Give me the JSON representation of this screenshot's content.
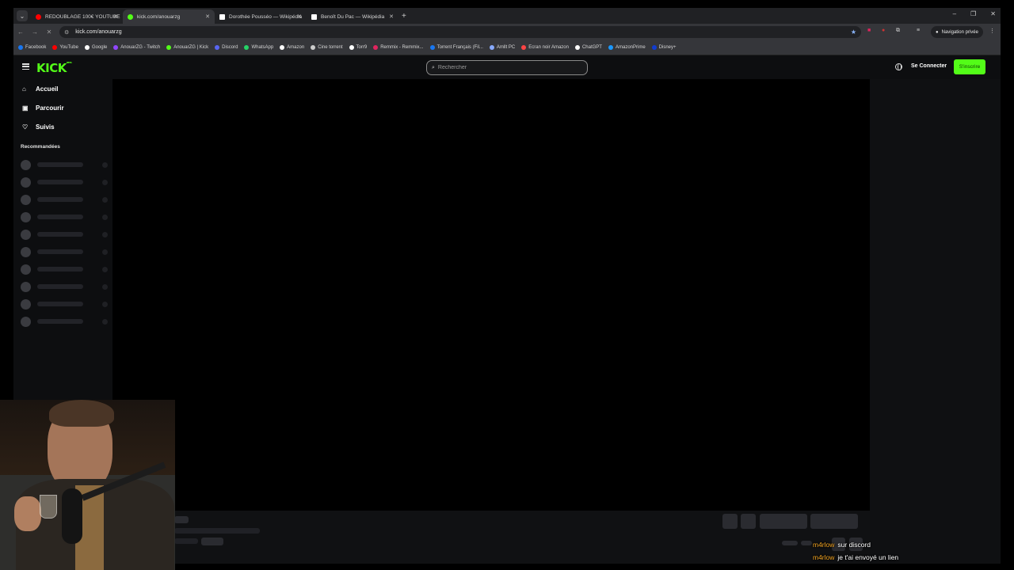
{
  "browser": {
    "tabs": [
      {
        "title": "REDOUBLAGE 100€ YOUTUBE",
        "icon": "youtube-icon",
        "color": "#ff0000"
      },
      {
        "title": "kick.com/anouarzg",
        "icon": "kick-icon",
        "color": "#53fc18",
        "active": true
      },
      {
        "title": "Dorothée Pousséo — Wikipédia",
        "icon": "wikipedia-icon",
        "color": "#ffffff"
      },
      {
        "title": "Benoît Du Pac — Wikipédia",
        "icon": "wikipedia-icon",
        "color": "#ffffff"
      }
    ],
    "url": "kick.com/anouarzg",
    "private_label": "Navigation privée",
    "bookmarks": [
      {
        "label": "Facebook",
        "color": "#1877f2"
      },
      {
        "label": "YouTube",
        "color": "#ff0000"
      },
      {
        "label": "Google",
        "color": "#ffffff"
      },
      {
        "label": "AnouarZG - Twitch",
        "color": "#9146ff"
      },
      {
        "label": "AnouarZG | Kick",
        "color": "#53fc18"
      },
      {
        "label": "Discord",
        "color": "#5865f2"
      },
      {
        "label": "WhatsApp",
        "color": "#25d366"
      },
      {
        "label": "Amazon",
        "color": "#ffffff"
      },
      {
        "label": "Cine torrent",
        "color": "#cccccc"
      },
      {
        "label": "Torr9",
        "color": "#ffffff"
      },
      {
        "label": "Remmix - Remmix...",
        "color": "#e0245e"
      },
      {
        "label": "Torrent Français (Fil...",
        "color": "#1877f2"
      },
      {
        "label": "Amllt PC",
        "color": "#88aaff"
      },
      {
        "label": "Ecran noir Amazon",
        "color": "#ff4444"
      },
      {
        "label": "ChatGPT",
        "color": "#ffffff"
      },
      {
        "label": "AmazonPrime",
        "color": "#1a98ff"
      },
      {
        "label": "Disney+",
        "color": "#113ccf"
      }
    ]
  },
  "kick": {
    "logo": "KICK",
    "logo_badge": "BETA",
    "search_placeholder": "Rechercher",
    "login_label": "Se Connecter",
    "signup_label": "S'inscrire",
    "nav": [
      {
        "label": "Accueil",
        "icon": "home-icon"
      },
      {
        "label": "Parcourir",
        "icon": "browse-icon"
      },
      {
        "label": "Suivis",
        "icon": "heart-icon"
      }
    ],
    "recommended_title": "Recommandées"
  },
  "chat_overlay": [
    {
      "user": "m4rlow",
      "text": "sur discord"
    },
    {
      "user": "m4rlow",
      "text": "je t'ai envoyé un lien"
    }
  ],
  "colors": {
    "accent": "#53fc18",
    "chat_user": "#f5a623"
  }
}
